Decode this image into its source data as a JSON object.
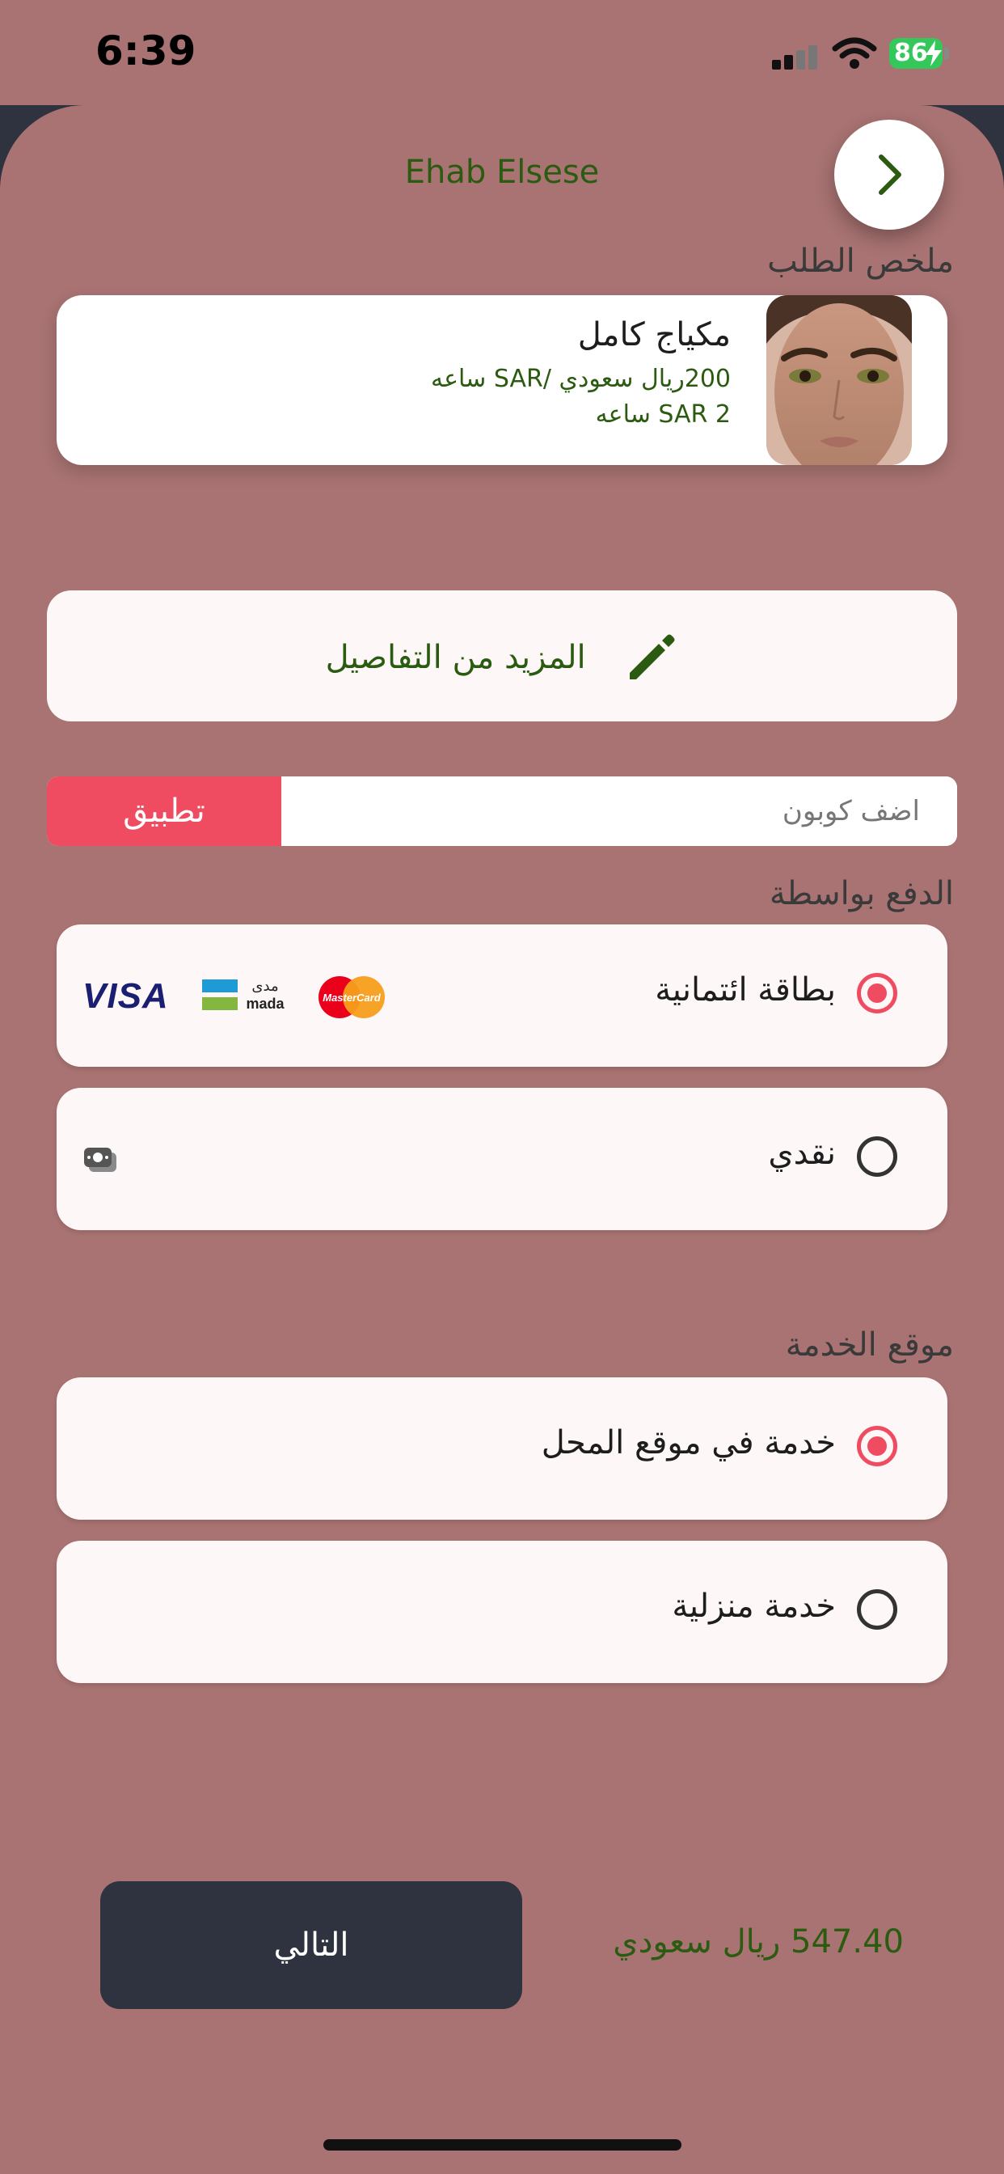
{
  "status_bar": {
    "time": "6:39",
    "battery": "86"
  },
  "header": {
    "user_name": "Ehab Elsese",
    "back_icon": "chevron-right-icon"
  },
  "order_summary": {
    "title": "ملخص الطلب",
    "service_name": "مكياج كامل",
    "price": "200ريال سعودي /SAR ساعه",
    "duration": "SAR 2 ساعه"
  },
  "more_details": {
    "label": "المزيد من التفاصيل",
    "icon": "pencil-icon"
  },
  "coupon": {
    "placeholder": "اضف كوبون",
    "apply_label": "تطبيق"
  },
  "payment": {
    "title": "الدفع بواسطة",
    "options": [
      {
        "label": "بطاقة ائتمانية",
        "selected": true,
        "icons": [
          "mastercard-icon",
          "mada-icon",
          "visa-icon"
        ],
        "visa_text": "VISA",
        "mada_ar": "مدى",
        "mada_en": "mada",
        "mc_text": "MasterCard"
      },
      {
        "label": "نقدي",
        "selected": false,
        "icons": [
          "cash-icon"
        ]
      }
    ]
  },
  "location": {
    "title": "موقع الخدمة",
    "options": [
      {
        "label": "خدمة في موقع المحل",
        "selected": true
      },
      {
        "label": "خدمة منزلية",
        "selected": false
      }
    ]
  },
  "footer": {
    "total": "547.40 ريال سعودي",
    "next_label": "التالي"
  },
  "colors": {
    "background": "#A87372",
    "accent": "#EF4B61",
    "green_text": "#2B5B11",
    "dark": "#2F323F"
  }
}
